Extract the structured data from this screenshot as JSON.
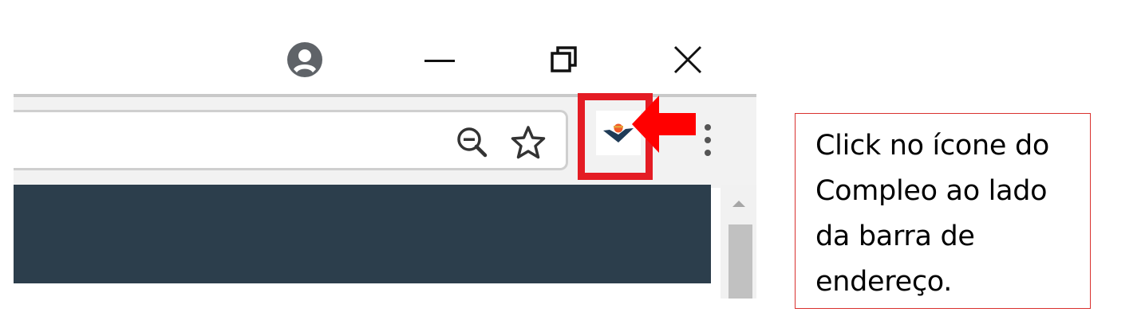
{
  "window_controls": {
    "profile_icon": "account-circle-icon",
    "minimize_icon": "minimize-icon",
    "restore_icon": "restore-icon",
    "close_icon": "close-icon"
  },
  "omnibox": {
    "zoom_icon": "zoom-out-icon",
    "bookmark_icon": "star-icon"
  },
  "extension": {
    "name": "Compleo",
    "icon": "compleo-extension-icon"
  },
  "menu": {
    "icon": "kebab-menu-icon"
  },
  "annotation": {
    "text": "Click no ícone do Compleo ao lado da barra de endereço.",
    "highlight_color": "#e41c24",
    "arrow_color": "#ff0000"
  },
  "colors": {
    "content_bg": "#2c3e4c",
    "toolbar_bg": "#f2f2f2",
    "callout_border": "#d9312e"
  }
}
